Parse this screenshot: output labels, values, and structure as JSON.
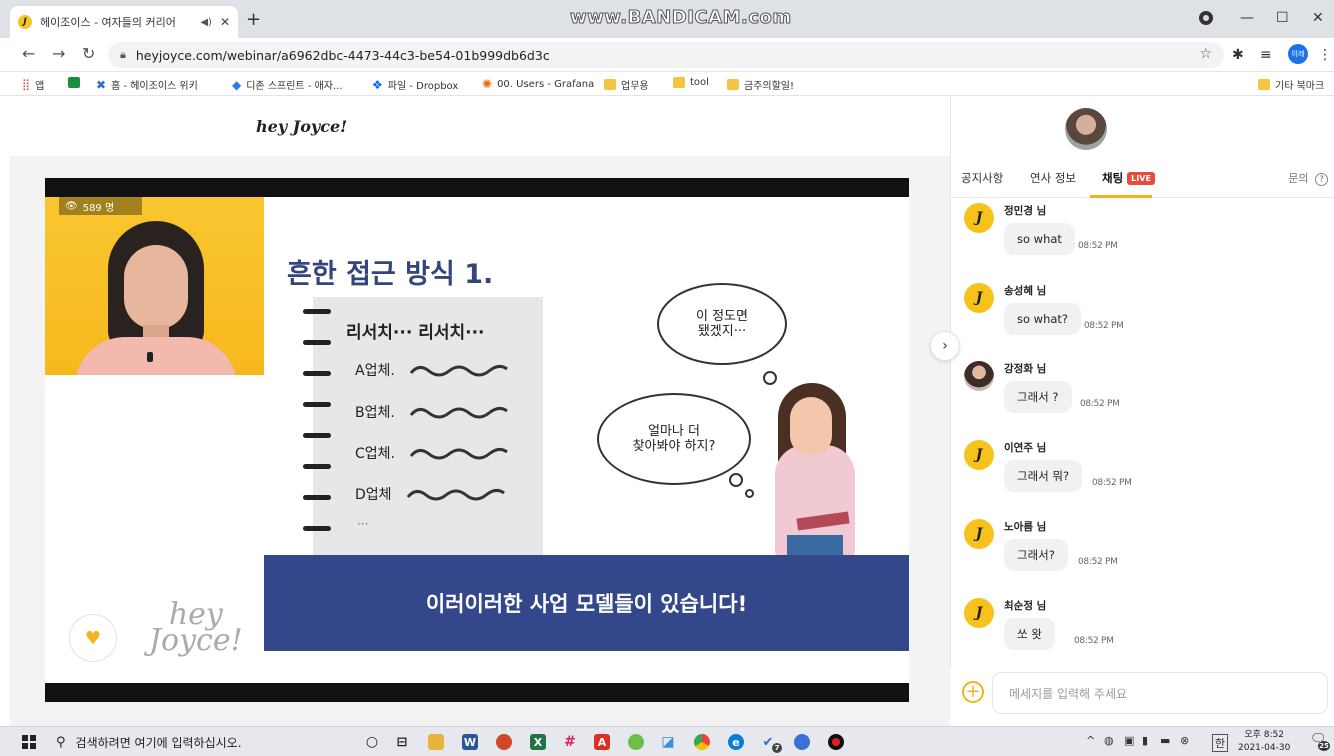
{
  "browser": {
    "tab_title": "헤이조이스 - 여자들의 커리어",
    "tab_favicon_letter": "J",
    "recording_watermark": "www.BANDICAM.com",
    "url": "heyjoyce.com/webinar/a6962dbc-4473-44c3-be54-01b999db6d3c",
    "profile_chip": "이레"
  },
  "bookmarks": [
    {
      "label": "앱"
    },
    {
      "label": "홈 - 헤이조이스 위키"
    },
    {
      "label": "디존 스프린트 - 애자..."
    },
    {
      "label": "파일 - Dropbox"
    },
    {
      "label": "00. Users - Grafana"
    },
    {
      "label": "업무용"
    },
    {
      "label": "tool"
    },
    {
      "label": "금주의할일!"
    },
    {
      "label": "기타 북마크"
    }
  ],
  "site": {
    "logo": "hey Joyce!"
  },
  "video": {
    "viewer_count": "589 명",
    "slide": {
      "title": "흔한 접근 방식 1.",
      "note_heading": "리서치··· 리서치···",
      "note_items": [
        "A업체.",
        "B업체.",
        "C업체.",
        "D업체"
      ],
      "note_more": "···",
      "bubble_top": "이 정도면\n됐겠지···",
      "bubble_bottom": "얼마나 더\n찾아봐야 하지?",
      "banner": "이러이러한 사업 모델들이 있습니다!",
      "watermark_line1": "hey",
      "watermark_line2": "Joyce!"
    }
  },
  "panel": {
    "tabs": {
      "notice": "공지사항",
      "speaker": "연사 정보",
      "chat": "채팅",
      "live_badge": "LIVE",
      "inquiry": "문의"
    },
    "messages": [
      {
        "name": "정민경 님",
        "text": "so what",
        "time": "08:52 PM",
        "avatar": "J"
      },
      {
        "name": "송성혜 님",
        "text": "so what?",
        "time": "08:52 PM",
        "avatar": "J"
      },
      {
        "name": "강정화 님",
        "text": "그래서 ?",
        "time": "08:52 PM",
        "avatar": ""
      },
      {
        "name": "이연주 님",
        "text": "그래서 뭐?",
        "time": "08:52 PM",
        "avatar": "J"
      },
      {
        "name": "노아름 님",
        "text": "그래서?",
        "time": "08:52 PM",
        "avatar": "J"
      },
      {
        "name": "최순정 님",
        "text": "쏘 왓",
        "time": "08:52 PM",
        "avatar": "J"
      }
    ],
    "composer_placeholder": "메세지를 입력해 주세요"
  },
  "taskbar": {
    "search_placeholder": "검색하려면 여기에 입력하십시오.",
    "ime": "한",
    "time": "오후 8:52",
    "date": "2021-04-30",
    "notification_count": "25",
    "badge_count": "7"
  }
}
